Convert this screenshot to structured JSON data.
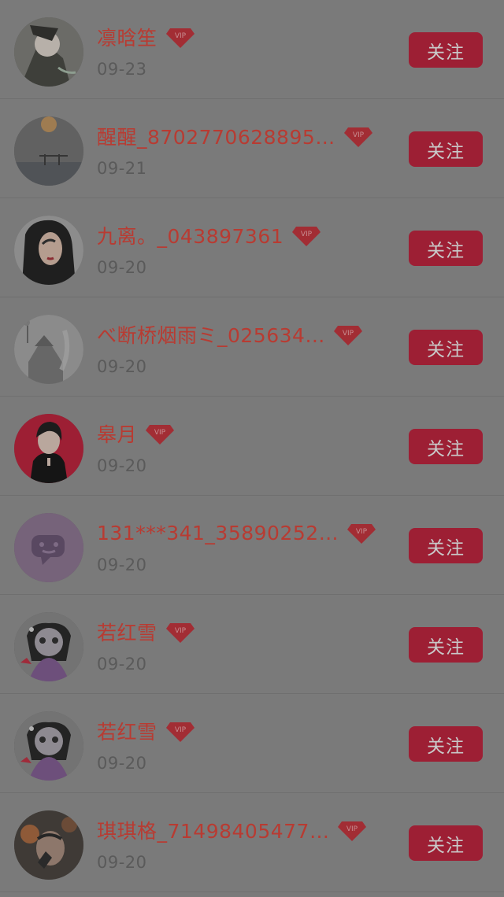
{
  "items": [
    {
      "name": "凛晗笙",
      "date": "09-23",
      "follow": "关注",
      "vip": "VIP"
    },
    {
      "name": "醒醒_8702770628895…",
      "date": "09-21",
      "follow": "关注",
      "vip": "VIP"
    },
    {
      "name": "九离。_043897361",
      "date": "09-20",
      "follow": "关注",
      "vip": "VIP"
    },
    {
      "name": "べ断桥烟雨ミ_025634…",
      "date": "09-20",
      "follow": "关注",
      "vip": "VIP"
    },
    {
      "name": "皋月",
      "date": "09-20",
      "follow": "关注",
      "vip": "VIP"
    },
    {
      "name": "131***341_35890252…",
      "date": "09-20",
      "follow": "关注",
      "vip": "VIP"
    },
    {
      "name": "若红雪",
      "date": "09-20",
      "follow": "关注",
      "vip": "VIP"
    },
    {
      "name": "若红雪",
      "date": "09-20",
      "follow": "关注",
      "vip": "VIP"
    },
    {
      "name": "琪琪格_71498405477…",
      "date": "09-20",
      "follow": "关注",
      "vip": "VIP"
    }
  ]
}
